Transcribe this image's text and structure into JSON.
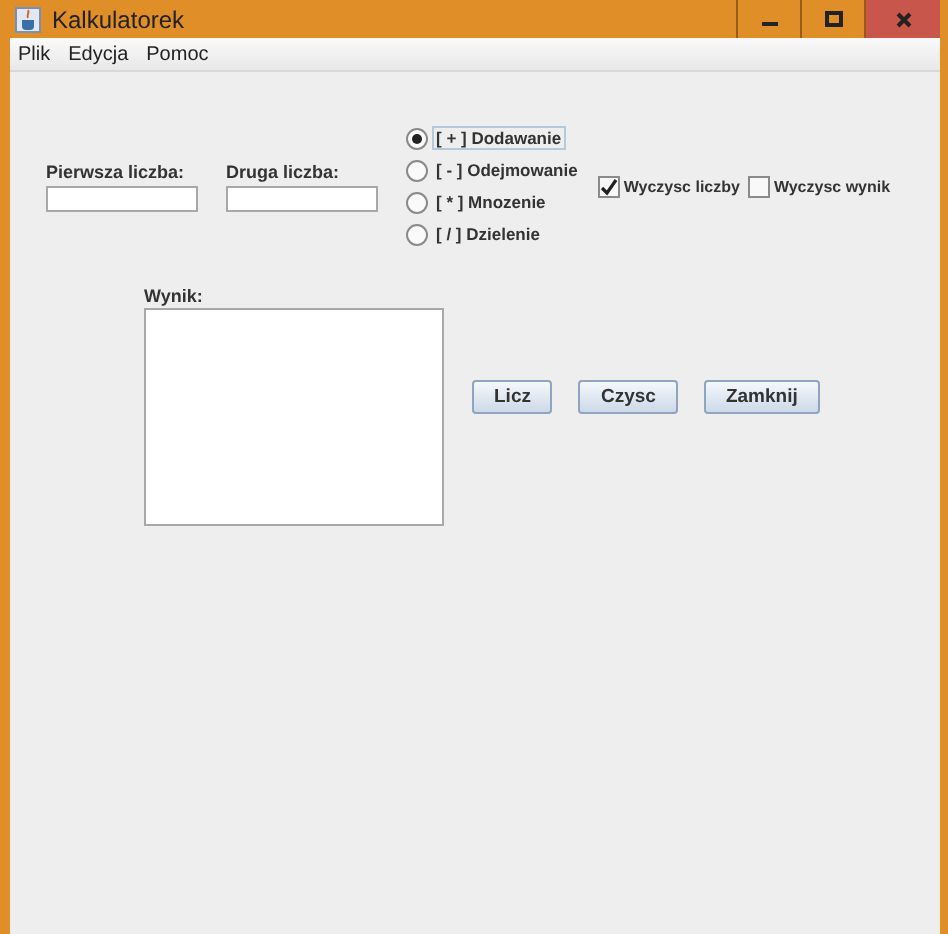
{
  "window": {
    "title": "Kalkulatorek"
  },
  "menu": [
    "Plik",
    "Edycja",
    "Pomoc"
  ],
  "fields": [
    {
      "label": "Pierwsza liczba:"
    },
    {
      "label": "Druga liczba:"
    }
  ],
  "operations": [
    {
      "label": "[ + ] Dodawanie",
      "selected": true
    },
    {
      "label": "[ - ] Odejmowanie",
      "selected": false
    },
    {
      "label": "[ * ] Mnozenie",
      "selected": false
    },
    {
      "label": "[ / ] Dzielenie",
      "selected": false
    }
  ],
  "options": [
    {
      "label": "Wyczysc liczby",
      "checked": true
    },
    {
      "label": "Wyczysc wynik",
      "checked": false
    }
  ],
  "result": {
    "label": "Wynik:"
  },
  "buttons": [
    "Licz",
    "Czysc",
    "Zamknij"
  ]
}
